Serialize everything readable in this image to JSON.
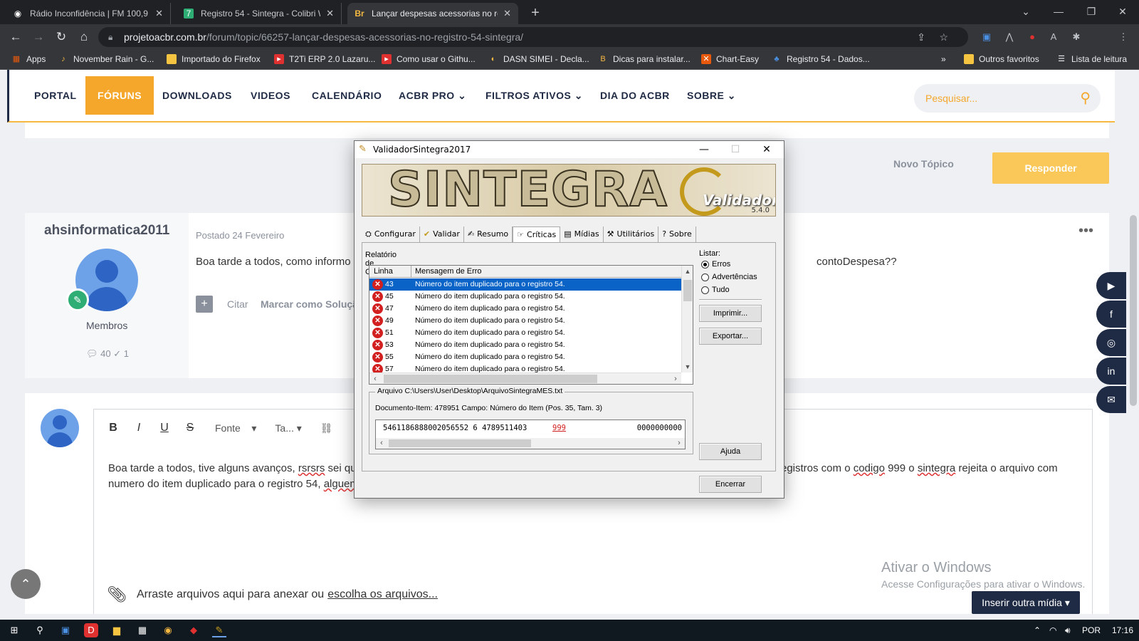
{
  "browser": {
    "tabs": [
      {
        "title": "Rádio Inconfidência | FM 100,9 B",
        "icon": "broadcast-icon"
      },
      {
        "title": "Registro 54 - Sintegra - Colibri W",
        "icon": "page-icon"
      },
      {
        "title": "Lançar despesas acessorias no re",
        "icon": "acbr-icon"
      }
    ],
    "url_host": "projetoacbr.com.br",
    "url_path": "/forum/topic/66257-lançar-despesas-acessorias-no-registro-54-sintegra/",
    "profile_initial": "a",
    "bookmarks": [
      {
        "label": "Apps",
        "icon": "apps-grid-icon"
      },
      {
        "label": "November Rain - G...",
        "icon": "music-icon"
      },
      {
        "label": "Importado do Firefox",
        "icon": "folder-icon"
      },
      {
        "label": "T2Ti ERP 2.0 Lazaru...",
        "icon": "youtube-icon"
      },
      {
        "label": "Como usar o Githu...",
        "icon": "youtube-icon"
      },
      {
        "label": "DASN SIMEI - Decla...",
        "icon": "gov-icon"
      },
      {
        "label": "Dicas para instalar...",
        "icon": "dicas-icon"
      },
      {
        "label": "Chart-Easy",
        "icon": "chart-icon"
      },
      {
        "label": "Registro 54 - Dados...",
        "icon": "registro-icon"
      }
    ],
    "more_bookmarks": "»",
    "other_favorites": "Outros favoritos",
    "reading_list": "Lista de leitura"
  },
  "site": {
    "nav": [
      "PORTAL",
      "FÓRUNS",
      "DOWNLOADS",
      "VIDEOS",
      "CALENDÁRIO",
      "ACBR PRO",
      "FILTROS ATIVOS",
      "DIA DO ACBR",
      "SOBRE"
    ],
    "nav_active": "FÓRUNS",
    "search_placeholder": "Pesquisar...",
    "novo_topico": "Novo Tópico",
    "responder": "Responder"
  },
  "post": {
    "username": "ahsinformatica2011",
    "group": "Membros",
    "posts_count": "40",
    "reputation": "1",
    "posted": "Postado 24 Fevereiro",
    "text_start": "Boa tarde a todos, como informo o",
    "text_end": "contoDespesa??",
    "citar": "Citar",
    "marcar": "Marcar como Solução"
  },
  "editor": {
    "bold": "B",
    "italic": "I",
    "underline": "U",
    "strike": "S",
    "font_select": "Fonte",
    "size_select": "Ta...",
    "line1_a": "Boa tarde a todos, tive alguns avanços,",
    "line1_b": "rsrsrs",
    "line1_c": "sei qu",
    "line1_d": "registros com o",
    "line1_e": "codigo",
    "line1_f": "999 o",
    "line1_g": "sintegra",
    "line1_h": "rejeita o arquivo com",
    "line2_a": "numero do item duplicado para o registro 54,",
    "line2_b": "alguem",
    "attach_text": "Arraste arquivos aqui para anexar ou",
    "attach_link": "escolha os arquivos...",
    "insert_media": "Inserir outra mídia ▾"
  },
  "watermark": {
    "title": "Ativar o Windows",
    "subtitle": "Acesse Configurações para ativar o Windows."
  },
  "dialog": {
    "title": "ValidadorSintegra2017",
    "banner_text": "SINTEGRA",
    "banner_sub": "Validador",
    "version": "5.4.0",
    "tabs": [
      {
        "label": "Configurar",
        "icon": "config-icon"
      },
      {
        "label": "Validar",
        "icon": "validate-icon"
      },
      {
        "label": "Resumo",
        "icon": "summary-icon"
      },
      {
        "label": "Críticas",
        "icon": "critics-icon"
      },
      {
        "label": "Mídias",
        "icon": "media-icon"
      },
      {
        "label": "Utilitários",
        "icon": "tools-icon"
      },
      {
        "label": "Sobre",
        "icon": "help-icon"
      }
    ],
    "active_tab": "Críticas",
    "report_label": "Relatório de Críticas:",
    "col_linha": "Linha",
    "col_msg": "Mensagem de Erro",
    "rows": [
      {
        "linha": "43",
        "msg": "Número do item duplicado para o registro 54."
      },
      {
        "linha": "45",
        "msg": "Número do item duplicado para o registro 54."
      },
      {
        "linha": "47",
        "msg": "Número do item duplicado para o registro 54."
      },
      {
        "linha": "49",
        "msg": "Número do item duplicado para o registro 54."
      },
      {
        "linha": "51",
        "msg": "Número do item duplicado para o registro 54."
      },
      {
        "linha": "53",
        "msg": "Número do item duplicado para o registro 54."
      },
      {
        "linha": "55",
        "msg": "Número do item duplicado para o registro 54."
      },
      {
        "linha": "57",
        "msg": "Número do item duplicado para o registro 54."
      }
    ],
    "listar_label": "Listar:",
    "radio_erros": "Erros",
    "radio_adv": "Advertências",
    "radio_tudo": "Tudo",
    "btn_imprimir": "Imprimir...",
    "btn_exportar": "Exportar...",
    "btn_ajuda": "Ajuda",
    "btn_encerrar": "Encerrar",
    "file_label": "Arquivo C:\\Users\\User\\Desktop\\ArquivoSintegraMES.txt",
    "doc_item": "Documento-Item: 478951  Campo: Número do Item (Pos. 35, Tam. 3)",
    "record_prefix": "5461186888002056552 6 4789511403",
    "record_highlight": "999",
    "record_suffix": "0000000000"
  },
  "taskbar": {
    "lang": "POR",
    "time": "17:16"
  }
}
